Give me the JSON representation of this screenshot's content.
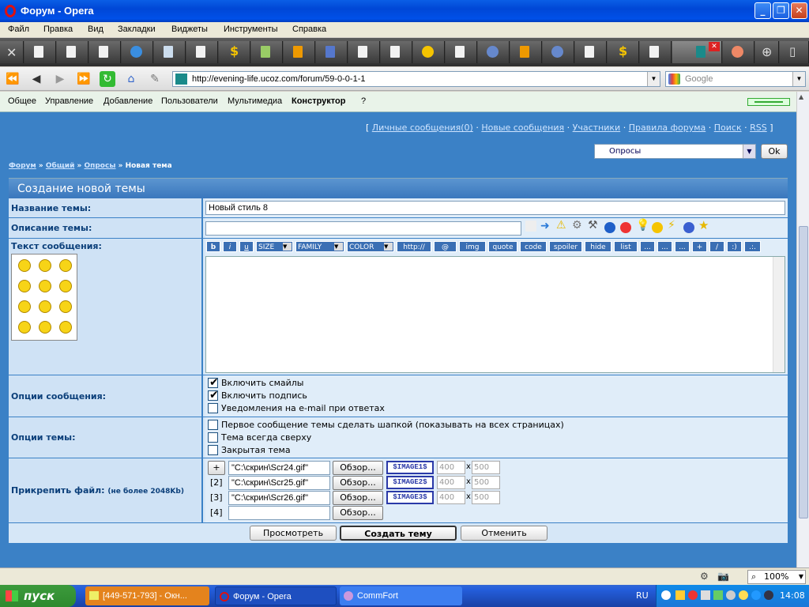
{
  "window": {
    "title": "Форум - Opera"
  },
  "menu": [
    "Файл",
    "Правка",
    "Вид",
    "Закладки",
    "Виджеты",
    "Инструменты",
    "Справка"
  ],
  "address": {
    "url": "http://evening-life.ucoz.com/forum/59-0-0-1-1",
    "search_placeholder": "Google"
  },
  "ucoz_panel": {
    "items": [
      "Общее",
      "Управление",
      "Добавление",
      "Пользователи",
      "Мультимедиа"
    ],
    "bold_item": "Конструктор",
    "help": "?"
  },
  "top_links": {
    "open": "[",
    "items": [
      "Личные сообщения(0)",
      "Новые сообщения",
      "Участники",
      "Правила форума",
      "Поиск",
      "RSS"
    ],
    "close": "]",
    "sep": "·"
  },
  "forum_select": {
    "value": "Опросы",
    "ok": "Ok"
  },
  "breadcrumb": {
    "items": [
      "Форум",
      "Общий",
      "Опросы"
    ],
    "current": "Новая тема",
    "sep": "»"
  },
  "form": {
    "header": "Создание новой темы",
    "title_label": "Название темы:",
    "title_value": "Новый стиль 8",
    "desc_label": "Описание темы:",
    "desc_value": "",
    "text_label": "Текст сообщения:",
    "bbcode": [
      "b",
      "i",
      "u",
      "SIZE",
      "FAMILY",
      "COLOR",
      "http://",
      "@",
      "img",
      "quote",
      "code",
      "spoiler",
      "hide",
      "list",
      "...",
      "...",
      "...",
      "+",
      "/",
      ":)",
      ".:."
    ],
    "msg_options_label": "Опции сообщения:",
    "msg_options": [
      {
        "label": "Включить смайлы",
        "checked": true
      },
      {
        "label": "Включить подпись",
        "checked": true
      },
      {
        "label": "Уведомления на e-mail при ответах",
        "checked": false
      }
    ],
    "topic_options_label": "Опции темы:",
    "topic_options": [
      {
        "label": "Первое сообщение темы сделать шапкой (показывать на всех страницах)",
        "checked": false
      },
      {
        "label": "Тема всегда сверху",
        "checked": false
      },
      {
        "label": "Закрытая тема",
        "checked": false
      }
    ],
    "attach_label": "Прикрепить файл:",
    "attach_note": "(не более 2048Kb)",
    "attach_add": "+",
    "attach_rows": [
      {
        "num": "",
        "file": "\"C:\\скрин\\Scr24.gif\"",
        "browse": "Обзор...",
        "tag": "$IMAGE1$",
        "w": "400",
        "x": "x",
        "h": "500"
      },
      {
        "num": "[2]",
        "file": "\"C:\\скрин\\Scr25.gif\"",
        "browse": "Обзор...",
        "tag": "$IMAGE2$",
        "w": "400",
        "x": "x",
        "h": "500"
      },
      {
        "num": "[3]",
        "file": "\"C:\\скрин\\Scr26.gif\"",
        "browse": "Обзор...",
        "tag": "$IMAGE3$",
        "w": "400",
        "x": "x",
        "h": "500"
      },
      {
        "num": "[4]",
        "file": "",
        "browse": "Обзор...",
        "tag": "",
        "w": "",
        "x": "",
        "h": ""
      }
    ],
    "preview": "Просмотреть",
    "submit": "Создать тему",
    "cancel": "Отменить"
  },
  "status": {
    "zoom": "100%"
  },
  "taskbar": {
    "start": "пуск",
    "tasks": [
      "[449-571-793] - Окн...",
      "Форум - Opera",
      "CommFort"
    ],
    "lang": "RU",
    "clock": "14:08"
  }
}
